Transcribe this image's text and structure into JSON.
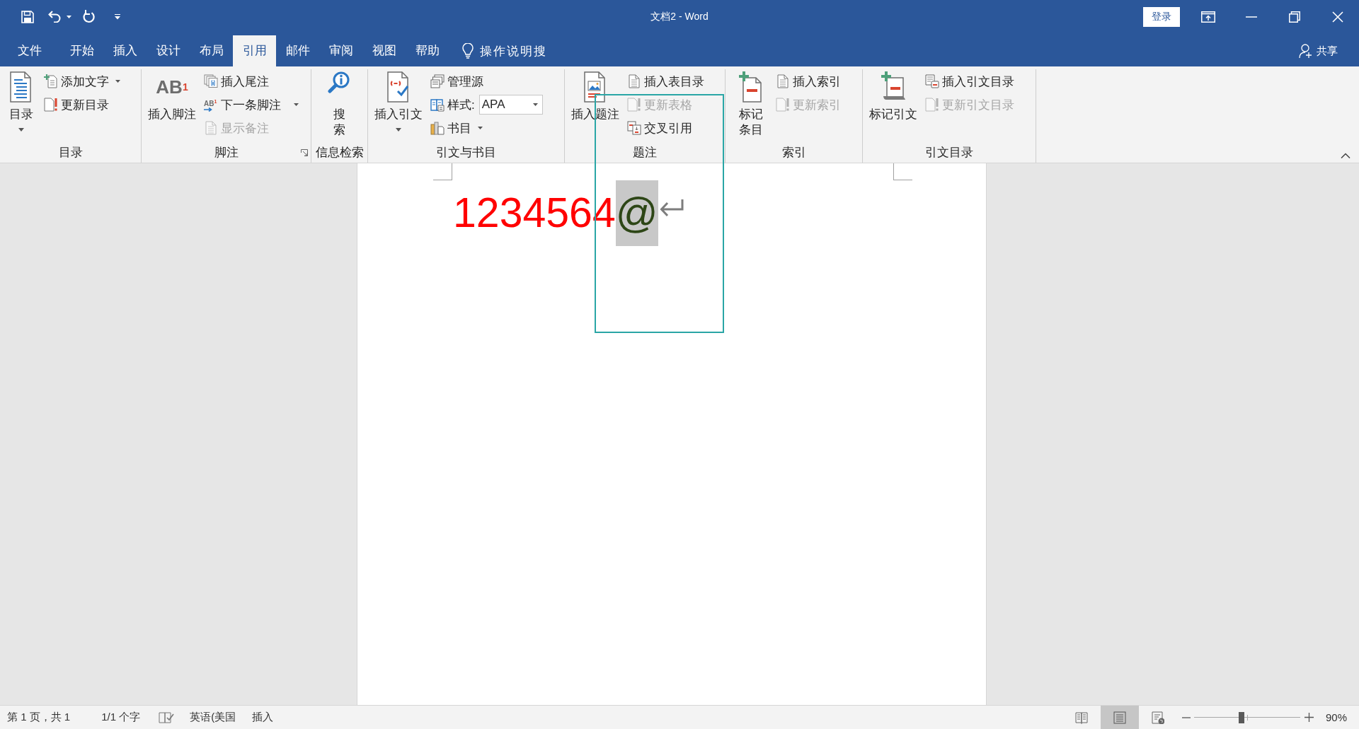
{
  "window": {
    "title": "文档2 - Word",
    "sign_in": "登录"
  },
  "tabs": [
    {
      "label": "文件",
      "selected": false
    },
    {
      "label": "开始",
      "selected": false
    },
    {
      "label": "插入",
      "selected": false
    },
    {
      "label": "设计",
      "selected": false
    },
    {
      "label": "布局",
      "selected": false
    },
    {
      "label": "引用",
      "selected": true
    },
    {
      "label": "邮件",
      "selected": false
    },
    {
      "label": "审阅",
      "selected": false
    },
    {
      "label": "视图",
      "selected": false
    },
    {
      "label": "帮助",
      "selected": false
    }
  ],
  "tell_me": "操作说明搜",
  "share": "共享",
  "ribbon": {
    "groups": [
      {
        "label": "目录",
        "launcher": false,
        "large": [
          {
            "lines": [
              "目录"
            ],
            "dropdown": true
          }
        ],
        "small": [
          {
            "kind": "button",
            "label": "添加文字",
            "dropdown": true,
            "disabled": false
          },
          {
            "kind": "button",
            "label": "更新目录",
            "dropdown": false,
            "disabled": false
          }
        ]
      },
      {
        "label": "脚注",
        "launcher": true,
        "large": [
          {
            "lines": [
              "插入脚注"
            ],
            "icon_text": "AB$^{1}$",
            "dropdown": false
          }
        ],
        "small": [
          {
            "kind": "button",
            "label": "插入尾注",
            "dropdown": false,
            "disabled": false
          },
          {
            "kind": "button",
            "label": "下一条脚注",
            "icon_text": "AB$^{1}$",
            "dropdown": true,
            "disabled": false
          },
          {
            "kind": "button",
            "label": "显示备注",
            "dropdown": false,
            "disabled": true
          }
        ]
      },
      {
        "label": "信息检索",
        "launcher": false,
        "large": [
          {
            "lines": [
              "搜",
              "索"
            ],
            "dropdown": false
          }
        ]
      },
      {
        "label": "引文与书目",
        "launcher": false,
        "large": [
          {
            "lines": [
              "插入引文"
            ],
            "dropdown": true
          }
        ],
        "small": [
          {
            "kind": "button",
            "label": "管理源",
            "dropdown": false,
            "disabled": false
          },
          {
            "kind": "select",
            "label": "样式:",
            "value": "APA"
          },
          {
            "kind": "button",
            "label": "书目",
            "dropdown": true,
            "disabled": false
          }
        ]
      },
      {
        "label": "题注",
        "launcher": false,
        "large": [
          {
            "lines": [
              "插入题注"
            ],
            "dropdown": false
          }
        ],
        "small": [
          {
            "kind": "button",
            "label": "插入表目录",
            "dropdown": false,
            "disabled": false
          },
          {
            "kind": "button",
            "label": "更新表格",
            "dropdown": false,
            "disabled": true
          },
          {
            "kind": "button",
            "label": "交叉引用",
            "dropdown": false,
            "disabled": false
          }
        ]
      },
      {
        "label": "索引",
        "launcher": false,
        "large": [
          {
            "lines": [
              "标记",
              "条目"
            ],
            "dropdown": false
          }
        ],
        "small": [
          {
            "kind": "button",
            "label": "插入索引",
            "dropdown": false,
            "disabled": false
          },
          {
            "kind": "button",
            "label": "更新索引",
            "dropdown": false,
            "disabled": true
          }
        ]
      },
      {
        "label": "引文目录",
        "launcher": false,
        "large": [
          {
            "lines": [
              "标记引文"
            ],
            "dropdown": false
          }
        ],
        "small": [
          {
            "kind": "button",
            "label": "插入引文目录",
            "dropdown": false,
            "disabled": false
          },
          {
            "kind": "button",
            "label": "更新引文目录",
            "dropdown": false,
            "disabled": true
          }
        ]
      }
    ]
  },
  "document": {
    "runs": [
      {
        "text": "1234564",
        "color": "#ff0000",
        "shaded": false
      },
      {
        "text": "@",
        "color": "#2d4616",
        "shaded": true
      }
    ]
  },
  "status_bar": {
    "page": "第 1 页，共 1",
    "words": "1/1 个字",
    "language": "英语(美国",
    "mode": "插入",
    "views": [
      {
        "selected": false
      },
      {
        "selected": true
      },
      {
        "selected": false
      }
    ],
    "zoom": {
      "level": 0.45,
      "reading": "90%"
    }
  }
}
